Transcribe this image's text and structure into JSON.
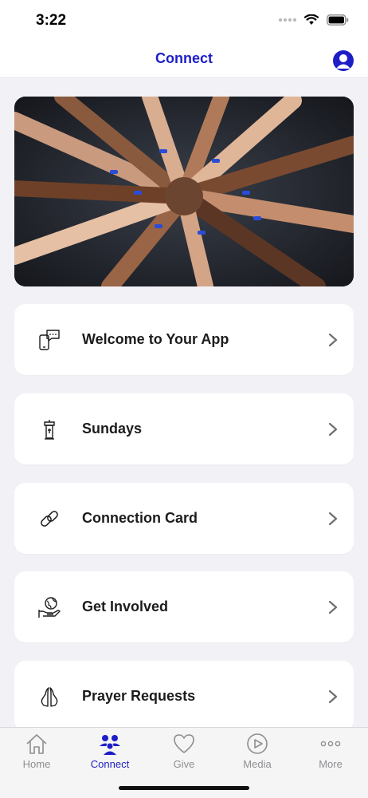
{
  "status_bar": {
    "time": "3:22"
  },
  "header": {
    "title": "Connect"
  },
  "menu": {
    "items": [
      {
        "label": "Welcome to Your App",
        "icon": "phone-chat-icon"
      },
      {
        "label": "Sundays",
        "icon": "pulpit-icon"
      },
      {
        "label": "Connection Card",
        "icon": "link-icon"
      },
      {
        "label": "Get Involved",
        "icon": "globe-hand-icon"
      },
      {
        "label": "Prayer Requests",
        "icon": "praying-hands-icon"
      }
    ]
  },
  "tab_bar": {
    "tabs": [
      {
        "label": "Home",
        "icon": "home-icon",
        "active": false
      },
      {
        "label": "Connect",
        "icon": "people-icon",
        "active": true
      },
      {
        "label": "Give",
        "icon": "heart-icon",
        "active": false
      },
      {
        "label": "Media",
        "icon": "play-icon",
        "active": false
      },
      {
        "label": "More",
        "icon": "more-dots-icon",
        "active": false
      }
    ]
  },
  "colors": {
    "accent": "#1e1ec8",
    "background": "#f2f2f6",
    "inactive": "#8e8e93"
  }
}
